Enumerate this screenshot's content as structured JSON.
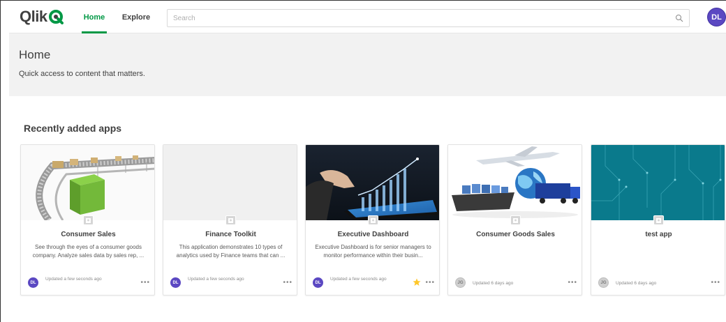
{
  "header": {
    "logo_text": "Qlik",
    "nav": [
      {
        "label": "Home",
        "active": true
      },
      {
        "label": "Explore",
        "active": false
      }
    ],
    "search_placeholder": "Search",
    "search_icon": "search-icon",
    "user_initials": "DL"
  },
  "hero": {
    "title": "Home",
    "subtitle": "Quick access to content that matters."
  },
  "section": {
    "title": "Recently added apps"
  },
  "apps": [
    {
      "title": "Consumer Sales",
      "description": "See through the eyes of a consumer goods company. Analyze sales data by sales rep, ...",
      "owner_initials": "DL",
      "updated": "Updated a few seconds ago",
      "favorite": false,
      "thumbnail": "conveyor-boxes"
    },
    {
      "title": "Finance Toolkit",
      "description": "This application demonstrates 10 types of analytics used by Finance teams that can ...",
      "owner_initials": "DL",
      "updated": "Updated a few seconds ago",
      "favorite": false,
      "thumbnail": "blank"
    },
    {
      "title": "Executive Dashboard",
      "description": "Executive Dashboard is for senior managers to monitor performance within their busin...",
      "owner_initials": "DL",
      "updated": "Updated a few seconds ago",
      "favorite": true,
      "thumbnail": "tablet-chart"
    },
    {
      "title": "Consumer Goods Sales",
      "description": "",
      "owner_initials": "JG",
      "updated": "Updated 6 days ago",
      "favorite": false,
      "thumbnail": "logistics"
    },
    {
      "title": "test app",
      "description": "",
      "owner_initials": "JG",
      "updated": "Updated 6 days ago",
      "favorite": false,
      "thumbnail": "circuit-teal"
    }
  ],
  "more_label": "•••",
  "colors": {
    "brand_green": "#009845",
    "avatar_purple": "#5b48c2",
    "hero_bg": "#f2f2f2",
    "star": "#ffc72a",
    "teal": "#0a7a8c"
  }
}
